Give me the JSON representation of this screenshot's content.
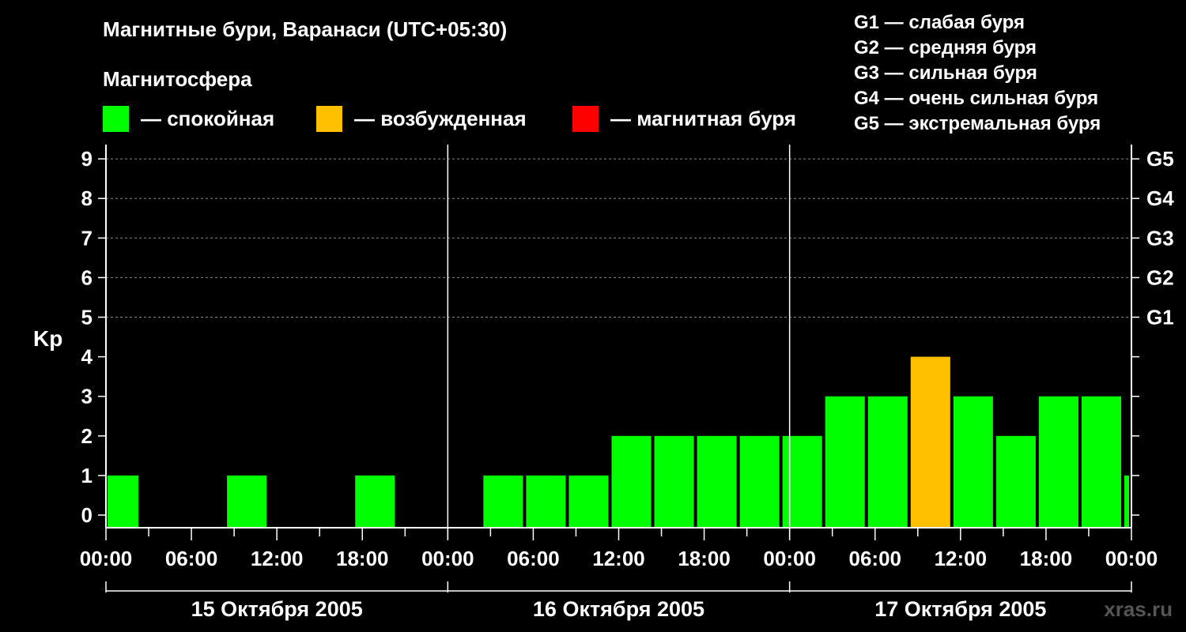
{
  "header": {
    "title": "Магнитные бури, Варанаси (UTC+05:30)",
    "legend_title": "Магнитосфера",
    "status_legend": [
      {
        "label": "— спокойная",
        "color": "#00FF00"
      },
      {
        "label": "— возбужденная",
        "color": "#FFC000"
      },
      {
        "label": "— магнитная буря",
        "color": "#FF0000"
      }
    ],
    "g_legend": [
      "G1 — слабая буря",
      "G2 — средняя буря",
      "G3 — сильная буря",
      "G4 — очень сильная буря",
      "G5 — экстремальная буря"
    ]
  },
  "watermark": "xras.ru",
  "chart_data": {
    "type": "bar",
    "ylabel": "Kp",
    "ylim": [
      0,
      9
    ],
    "y_ticks": [
      "0",
      "1",
      "2",
      "3",
      "4",
      "5",
      "6",
      "7",
      "8",
      "9"
    ],
    "g_levels": [
      {
        "label": "G1",
        "kp": 5
      },
      {
        "label": "G2",
        "kp": 6
      },
      {
        "label": "G3",
        "kp": 7
      },
      {
        "label": "G4",
        "kp": 8
      },
      {
        "label": "G5",
        "kp": 9
      }
    ],
    "grid_dashed_kp": [
      5,
      6,
      7,
      8,
      9
    ],
    "x_tick_labels": [
      "00:00",
      "06:00",
      "12:00",
      "18:00",
      "00:00",
      "06:00",
      "12:00",
      "18:00",
      "00:00",
      "06:00",
      "12:00",
      "18:00",
      "00:00"
    ],
    "days": [
      "15 Октября 2005",
      "16 Октября 2005",
      "17 Октября 2005"
    ],
    "bar_colors": {
      "quiet": "#00FF00",
      "active": "#FFC000",
      "storm": "#FF0000"
    },
    "x_unit": "hours from 15 Октября 2005 00:00",
    "bars": [
      {
        "start": 0,
        "end": 2.5,
        "kp": 1,
        "status": "quiet"
      },
      {
        "start": 8.5,
        "end": 11.5,
        "kp": 1,
        "status": "quiet"
      },
      {
        "start": 17.5,
        "end": 20.5,
        "kp": 1,
        "status": "quiet"
      },
      {
        "start": 26.5,
        "end": 29.5,
        "kp": 1,
        "status": "quiet"
      },
      {
        "start": 29.5,
        "end": 32.5,
        "kp": 1,
        "status": "quiet"
      },
      {
        "start": 32.5,
        "end": 35.5,
        "kp": 1,
        "status": "quiet"
      },
      {
        "start": 35.5,
        "end": 38.5,
        "kp": 2,
        "status": "quiet"
      },
      {
        "start": 38.5,
        "end": 41.5,
        "kp": 2,
        "status": "quiet"
      },
      {
        "start": 41.5,
        "end": 44.5,
        "kp": 2,
        "status": "quiet"
      },
      {
        "start": 44.5,
        "end": 47.5,
        "kp": 2,
        "status": "quiet"
      },
      {
        "start": 47.5,
        "end": 50.5,
        "kp": 2,
        "status": "quiet"
      },
      {
        "start": 50.5,
        "end": 53.5,
        "kp": 3,
        "status": "quiet"
      },
      {
        "start": 53.5,
        "end": 56.5,
        "kp": 3,
        "status": "quiet"
      },
      {
        "start": 56.5,
        "end": 59.5,
        "kp": 4,
        "status": "active"
      },
      {
        "start": 59.5,
        "end": 62.5,
        "kp": 3,
        "status": "quiet"
      },
      {
        "start": 62.5,
        "end": 65.5,
        "kp": 2,
        "status": "quiet"
      },
      {
        "start": 65.5,
        "end": 68.5,
        "kp": 3,
        "status": "quiet"
      },
      {
        "start": 68.5,
        "end": 71.5,
        "kp": 3,
        "status": "quiet"
      },
      {
        "start": 71.5,
        "end": 72,
        "kp": 1,
        "status": "quiet"
      }
    ]
  }
}
